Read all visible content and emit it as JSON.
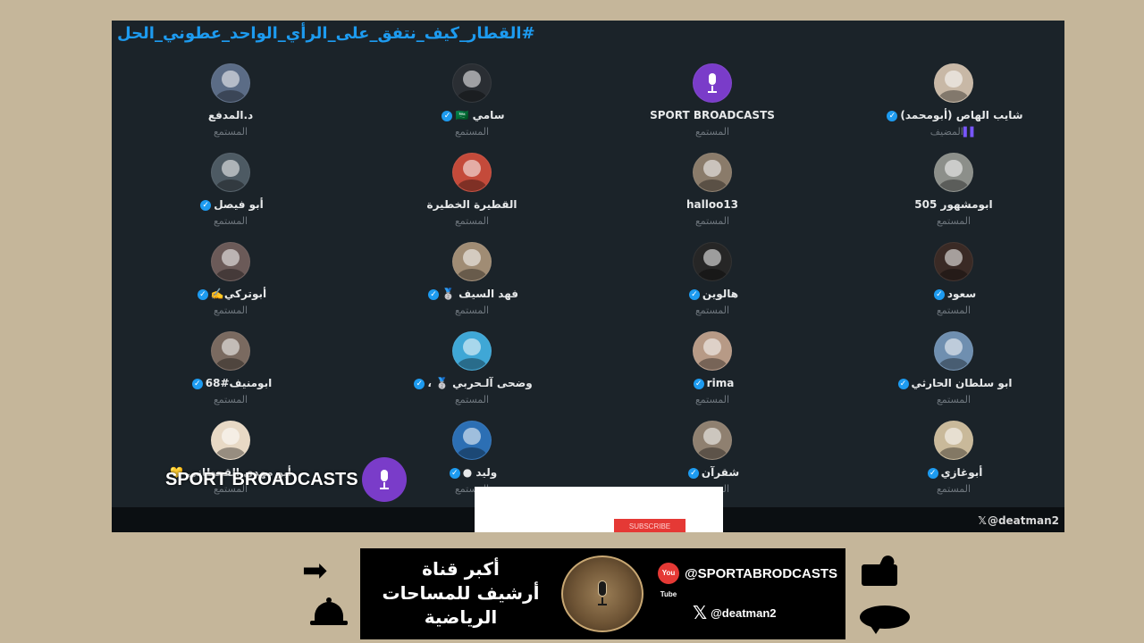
{
  "space": {
    "hashtag": "#القطار_كيف_نتفق_على_الرأي_الواحد_عطوني_الحل",
    "footer_handle": "@deatman2"
  },
  "participants": [
    {
      "name": "شايب الهاص (أبومحمد)",
      "verified": true,
      "role": "المضيف",
      "avatar_color": "#c8b8a6"
    },
    {
      "name": "SPORT BROADCASTS",
      "verified": false,
      "role": "المستمع",
      "avatar_color": "#7a3cc9",
      "mic_avatar": true
    },
    {
      "name": "سامي 🇸🇦",
      "verified": true,
      "role": "المستمع",
      "avatar_color": "#2a2e33"
    },
    {
      "name": "د.المدفع",
      "verified": false,
      "role": "المستمع",
      "avatar_color": "#5b6c86"
    },
    {
      "name": "ابومشهور 505",
      "verified": false,
      "role": "المستمع",
      "avatar_color": "#8c8f8a"
    },
    {
      "name": "halloo13",
      "verified": false,
      "role": "المستمع",
      "avatar_color": "#8a7b6a"
    },
    {
      "name": "القطيرة الخطيرة",
      "verified": false,
      "role": "المستمع",
      "avatar_color": "#c44a3a"
    },
    {
      "name": "أبو فيصل",
      "verified": true,
      "role": "المستمع",
      "avatar_color": "#4d5a63"
    },
    {
      "name": "سعود",
      "verified": true,
      "role": "المستمع",
      "avatar_color": "#3a2a25"
    },
    {
      "name": "هالوين",
      "verified": true,
      "role": "المستمع",
      "avatar_color": "#262626"
    },
    {
      "name": "فهد السيف 🥈",
      "verified": true,
      "role": "المستمع",
      "avatar_color": "#a08c74"
    },
    {
      "name": "أبوتركي✍️",
      "verified": true,
      "role": "المستمع",
      "avatar_color": "#6b5a58"
    },
    {
      "name": "ابو سلطان الحارثي",
      "verified": true,
      "role": "المستمع",
      "avatar_color": "#6f8fb0"
    },
    {
      "name": "rima",
      "verified": true,
      "role": "المستمع",
      "avatar_color": "#b79a86"
    },
    {
      "name": "وضحى آلـحربي 🥈 ،",
      "verified": true,
      "role": "المستمع",
      "avatar_color": "#3fa7d6"
    },
    {
      "name": "ابومنيف#68",
      "verified": true,
      "role": "المستمع",
      "avatar_color": "#7a6a60"
    },
    {
      "name": "أبوغازي",
      "verified": true,
      "role": "المستمع",
      "avatar_color": "#c9b99a"
    },
    {
      "name": "شقرآن",
      "verified": true,
      "role": "المستمع",
      "avatar_color": "#8f8070"
    },
    {
      "name": "وليد ●",
      "verified": true,
      "role": "المستمع",
      "avatar_color": "#2c6fb4"
    },
    {
      "name": "أبو مهدي القحطاني 💛",
      "verified": false,
      "role": "المستمع",
      "avatar_color": "#e8d9c5"
    }
  ],
  "overlay": {
    "brand": "SPORT BROADCASTS",
    "subscribe_label": "SUBSCRIBE"
  },
  "banner": {
    "line1": "أكبر قناة",
    "line2": "أرشيف للمساحات",
    "line3": "الرياضية",
    "youtube_label": "You Tube",
    "youtube_handle": "@SPORTABRODCASTS",
    "x_handle": "@deatman2"
  },
  "icons": {
    "arrow": "arrow-right-icon",
    "bell": "bell-icon",
    "like": "thumbs-up-icon",
    "comment": "comment-icon"
  }
}
